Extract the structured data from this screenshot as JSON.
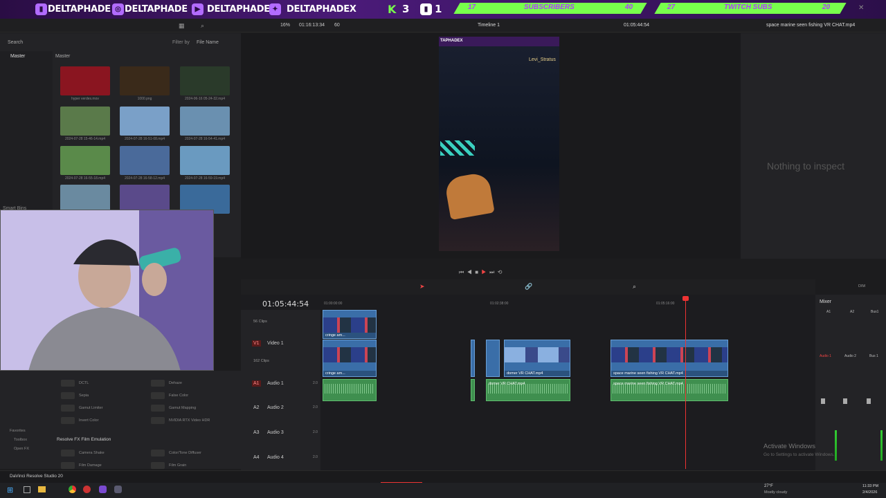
{
  "banner": {
    "handle1": "DELTAPHADE",
    "handle2": "DELTAPHADE",
    "handle3": "DELTAPHADE",
    "handle4": "DELTAPHADEX",
    "k_count": "3",
    "t_count": "1",
    "sub_count": "17",
    "sub_label": "SUBSCRIBERS",
    "sub_goal": "40",
    "twitch_count": "27",
    "twitch_label": "TWITCH SUBS",
    "twitch_goal": "20"
  },
  "toolbar": {
    "zoom": "16%",
    "timecode_top": "01:16:13:34",
    "fps": "60",
    "timeline_name": "Timeline 1",
    "timecode_right": "01:05:44:54",
    "clip_title": "space marine seen fishing VR CHAT.mp4"
  },
  "media": {
    "search": "Search",
    "filter_label": "Filter by",
    "filter_value": "File Name",
    "master_label": "Master",
    "bin": "Master",
    "smart_bins": "Smart Bins",
    "thumbs": [
      {
        "name": "hyper verdes.mov",
        "color": "#8a1520"
      },
      {
        "name": "1000.png",
        "color": "#3a2a1a"
      },
      {
        "name": "2024-06-16 05-24-32.mp4",
        "color": "#2a3a2a"
      },
      {
        "name": "2024-07-28 15-46-14.mp4",
        "color": "#5a7a4a"
      },
      {
        "name": "2024-07-28 16-51-08.mp4",
        "color": "#7aa0c8"
      },
      {
        "name": "2024-07-28 16-54-41.mp4",
        "color": "#6a90b0"
      },
      {
        "name": "2024-07-28 16-55-18.mp4",
        "color": "#5a8a4a"
      },
      {
        "name": "2024-07-28 16-58-12.mp4",
        "color": "#4a6a9a"
      },
      {
        "name": "2024-07-28 16-59-19.mp4",
        "color": "#6a9ac0"
      },
      {
        "name": "",
        "color": "#6a8aa0"
      },
      {
        "name": "",
        "color": "#5a4a8a"
      },
      {
        "name": "",
        "color": "#3a6a9a"
      }
    ]
  },
  "effects": {
    "items_l": [
      "DCTL",
      "Sepia",
      "Gamut Limiter",
      "Invert Color"
    ],
    "items_r": [
      "Dehaze",
      "False Color",
      "Gamut Mapping",
      "NVIDIA RTX Video HDR"
    ],
    "group": "Resolve FX Film Emulation",
    "items2_l": [
      "Camera Shake",
      "Film Damage"
    ],
    "items2_r": [
      "Color/Tone Diffuser",
      "Film Grain"
    ],
    "favorites": "Favorites",
    "toolbox": "Toolbox",
    "open_fx": "Open FX"
  },
  "viewer": {
    "overlay_user": "Levi_Stratus",
    "overlay_banner": "TAPHADEX"
  },
  "inspector": {
    "empty": "Nothing to inspect"
  },
  "timeline": {
    "timecode": "01:05:44:54",
    "ruler": [
      "01:00:00:00",
      "01:02:38:00",
      "01:05:16:00"
    ],
    "tracks": [
      {
        "id": "V1",
        "name": "Video 1",
        "clips": "162 Clips"
      },
      {
        "id": "A1",
        "name": "Audio 1",
        "level": "2.0"
      },
      {
        "id": "A2",
        "name": "Audio 2",
        "level": "2.0"
      },
      {
        "id": "A3",
        "name": "Audio 3",
        "level": "2.0"
      },
      {
        "id": "A4",
        "name": "Audio 4",
        "level": "2.0"
      }
    ],
    "upper_clips": "56 Clips",
    "clip1": "cringe am...",
    "clip2": "cringe am...",
    "clip3": "domer VR CHAT.mp4",
    "clip4": "space marine seen fishing VR CHAT.mp4",
    "clip5": "domer VR CHAT.mp4",
    "clip6": "space marine seen fishing VR CHAT.mp4"
  },
  "mixer": {
    "title": "Mixer",
    "a1": "A1",
    "a2": "A2",
    "bus": "Bus1",
    "audio1": "Audio 1",
    "audio2": "Audio 2",
    "bus1": "Bus 1",
    "dim": "DIM"
  },
  "watermark": {
    "line1": "Activate Windows",
    "line2": "Go to Settings to activate Windows."
  },
  "app": {
    "name": "DaVinci Resolve Studio 20"
  },
  "taskbar": {
    "weather_temp": "27°F",
    "weather_desc": "Mostly cloudy",
    "time": "11:33 PM",
    "date": "2/4/2026"
  }
}
